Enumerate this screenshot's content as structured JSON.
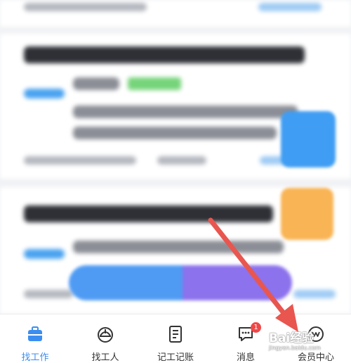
{
  "tabs": [
    {
      "label": "找工作",
      "icon": "briefcase-icon",
      "active": true
    },
    {
      "label": "找工人",
      "icon": "hardhat-icon",
      "active": false
    },
    {
      "label": "记工记账",
      "icon": "ledger-icon",
      "active": false
    },
    {
      "label": "消息",
      "icon": "chat-bubble-icon",
      "active": false,
      "badge": "1"
    },
    {
      "label": "会员中心",
      "icon": "member-icon",
      "active": false
    }
  ],
  "watermark": {
    "brand": "Bai经验",
    "url": "jingyan.baidu.com"
  },
  "colors": {
    "active": "#3b8ef0",
    "inactive": "#333333",
    "badge": "#f04848",
    "annotation_arrow": "#e8564f"
  }
}
